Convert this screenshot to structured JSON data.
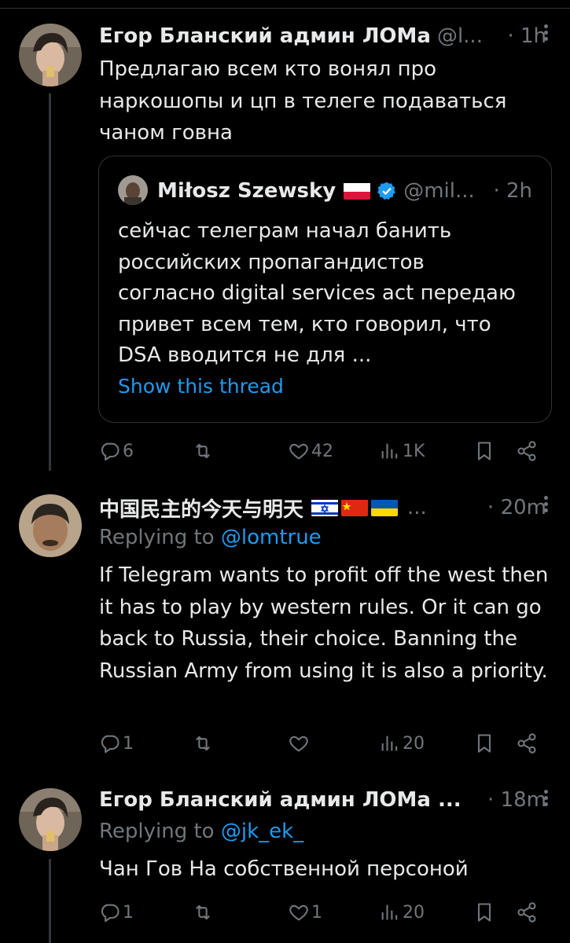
{
  "tweets": [
    {
      "author": "Егор Бланский админ ЛОМа",
      "handle": "@l...",
      "time": "· 1h",
      "text": "Предлагаю всем кто вонял про наркошопы и цп в телеге подаваться чаном говна",
      "quote": {
        "author": "Miłosz Szewsky",
        "handle": "@mil...",
        "time": "· 2h",
        "text": "сейчас телеграм начал банить российских пропагандистов согласно digital services act передаю привет всем тем, кто говорил, что DSA вводится не для ...",
        "show_thread": "Show this thread"
      },
      "actions": {
        "replies": "6",
        "retweets": "",
        "likes": "42",
        "views": "1K"
      }
    },
    {
      "author": "中国民主的今天与明天",
      "ellipsis": "...",
      "time": "· 20m",
      "replying_label": "Replying to",
      "replying_to": "@lomtrue",
      "text": "If Telegram wants to profit off the west then it has to play by western rules. Or it can go back to Russia, their choice. Banning the Russian Army from using it is also a priority.",
      "actions": {
        "replies": "1",
        "retweets": "",
        "likes": "",
        "views": "20"
      }
    },
    {
      "author": "Егор Бланский админ ЛОМа ...",
      "time": "· 18m",
      "replying_label": "Replying to",
      "replying_to": "@jk_ek_",
      "text": "Чан Гов На собственной персоной",
      "actions": {
        "replies": "1",
        "retweets": "",
        "likes": "1",
        "views": "20"
      }
    }
  ],
  "colors": {
    "background": "#000000",
    "text": "#e7e9ea",
    "muted": "#71767b",
    "link": "#1d9bf0",
    "verified": "#1d9bf0"
  },
  "icons": [
    "reply-icon",
    "retweet-icon",
    "like-icon",
    "views-icon",
    "bookmark-icon",
    "share-icon",
    "more-icon",
    "verified-badge-icon"
  ]
}
